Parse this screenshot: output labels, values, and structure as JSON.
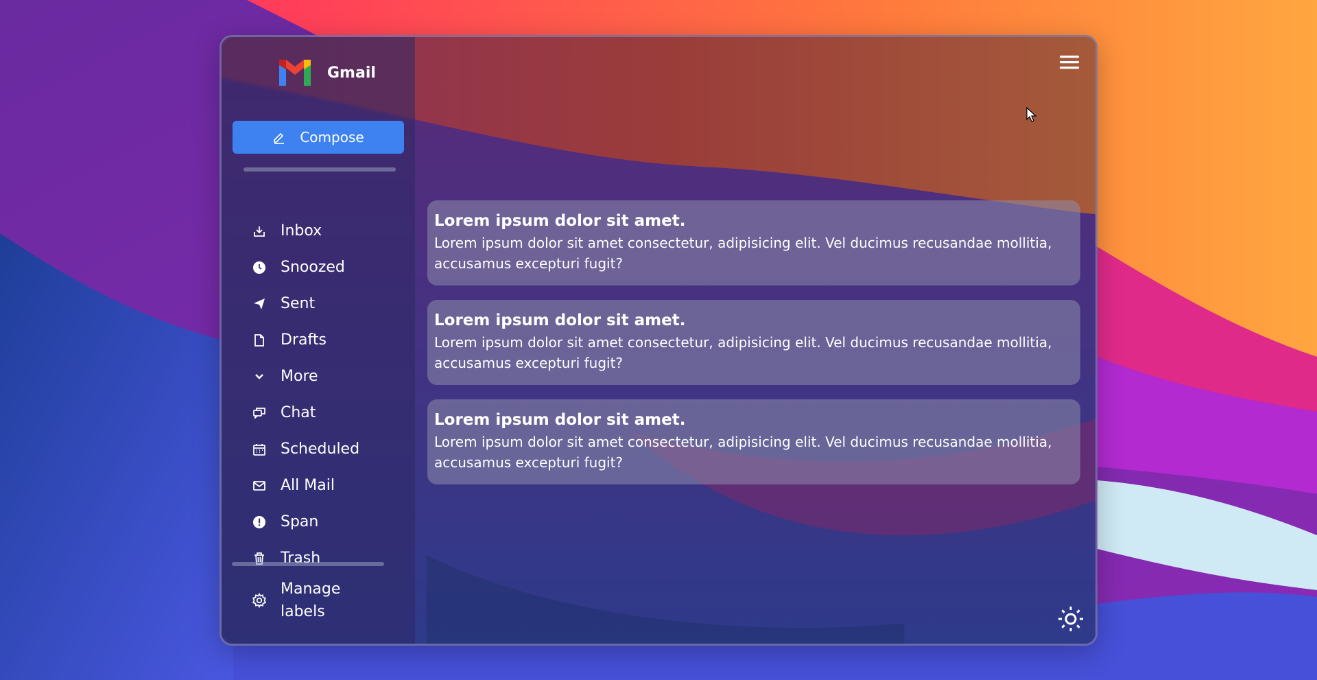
{
  "app": {
    "name": "Gmail"
  },
  "sidebar": {
    "compose_label": "Compose",
    "items": [
      {
        "label": "Inbox",
        "icon": "inbox-icon"
      },
      {
        "label": "Snoozed",
        "icon": "clock-icon"
      },
      {
        "label": "Sent",
        "icon": "send-icon"
      },
      {
        "label": "Drafts",
        "icon": "draft-icon"
      },
      {
        "label": "More",
        "icon": "chevron-down-icon"
      },
      {
        "label": "Chat",
        "icon": "chat-icon"
      },
      {
        "label": "Scheduled",
        "icon": "calendar-icon"
      },
      {
        "label": "All Mail",
        "icon": "mail-icon"
      },
      {
        "label": "Span",
        "icon": "alert-icon"
      },
      {
        "label": "Trash",
        "icon": "trash-icon"
      }
    ],
    "manage_labels": "Manage labels"
  },
  "emails": [
    {
      "title": "Lorem ipsum dolor sit amet.",
      "body": "Lorem ipsum dolor sit amet consectetur, adipisicing elit. Vel ducimus recusandae mollitia, accusamus excepturi fugit?"
    },
    {
      "title": "Lorem ipsum dolor sit amet.",
      "body": "Lorem ipsum dolor sit amet consectetur, adipisicing elit. Vel ducimus recusandae mollitia, accusamus excepturi fugit?"
    },
    {
      "title": "Lorem ipsum dolor sit amet.",
      "body": "Lorem ipsum dolor sit amet consectetur, adipisicing elit. Vel ducimus recusandae mollitia, accusamus excepturi fugit?"
    }
  ],
  "colors": {
    "accent": "#3d82f0",
    "text": "#ffffff"
  }
}
